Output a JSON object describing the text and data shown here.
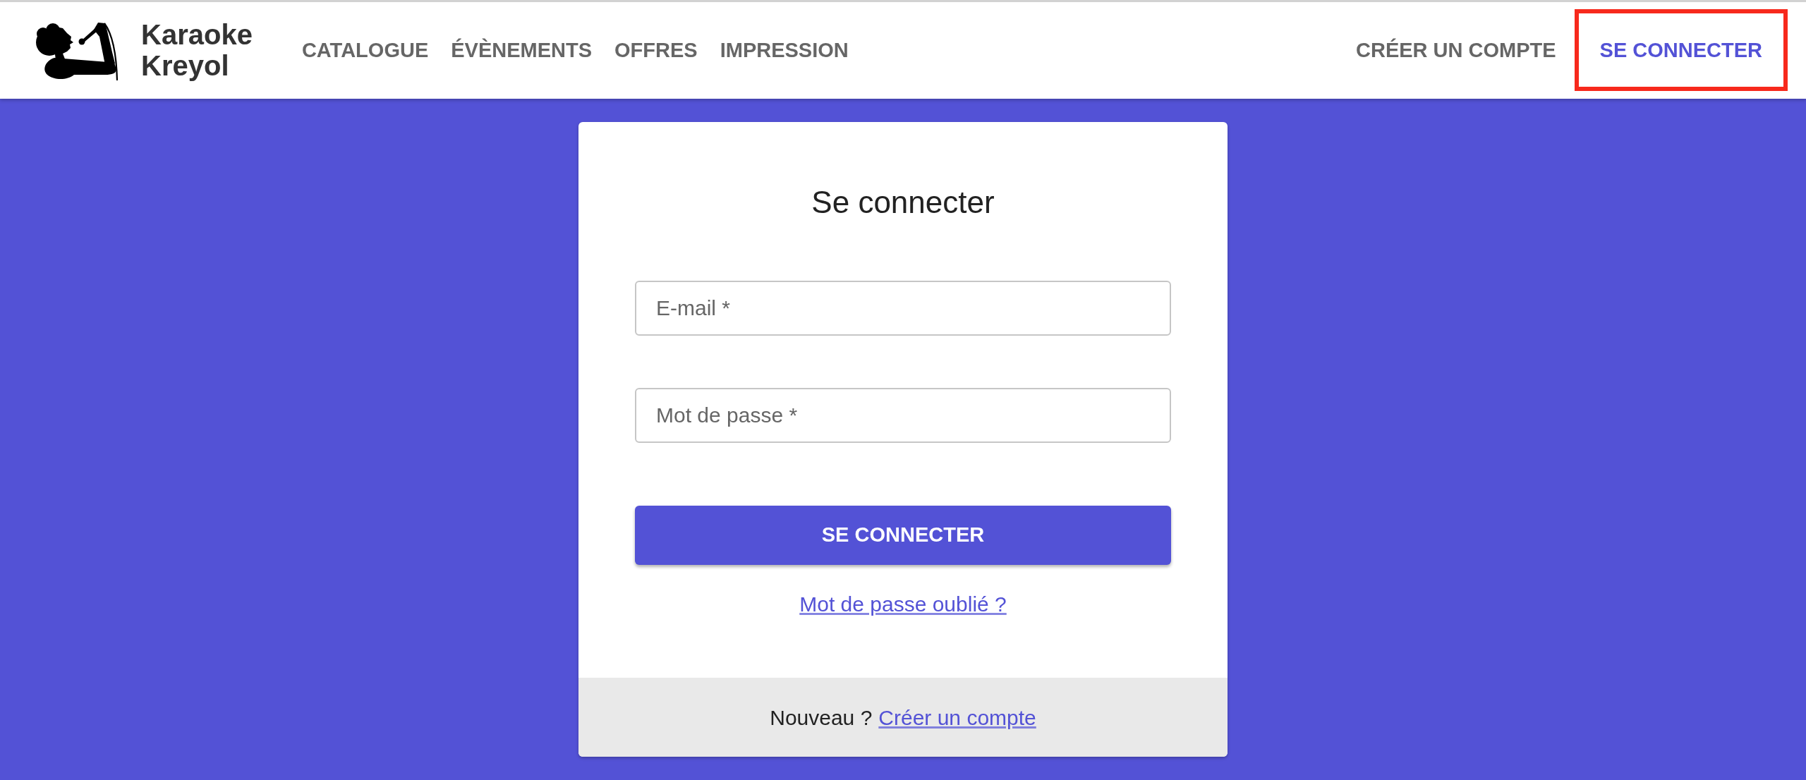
{
  "navbar": {
    "brand": "Karaoke Kreyol",
    "links": [
      {
        "label": "CATALOGUE",
        "selected": false
      },
      {
        "label": "ÉVÈNEMENTS",
        "selected": false
      },
      {
        "label": "OFFRES",
        "selected": false
      },
      {
        "label": "IMPRESSION",
        "selected": false
      }
    ],
    "account_links": [
      {
        "label": "CRÉER UN COMPTE",
        "selected": false,
        "highlighted": false
      },
      {
        "label": "SE CONNECTER",
        "selected": true,
        "highlighted": true
      }
    ]
  },
  "login_card": {
    "title": "Se connecter",
    "fields": [
      {
        "placeholder": "E-mail *"
      },
      {
        "placeholder": "Mot de passe *"
      }
    ],
    "submit_button": "SE CONNECTER",
    "forgot_password_link": "Mot de passe oublié ?",
    "footer": {
      "text": "Nouveau ?",
      "link": "Créer un compte"
    }
  }
}
